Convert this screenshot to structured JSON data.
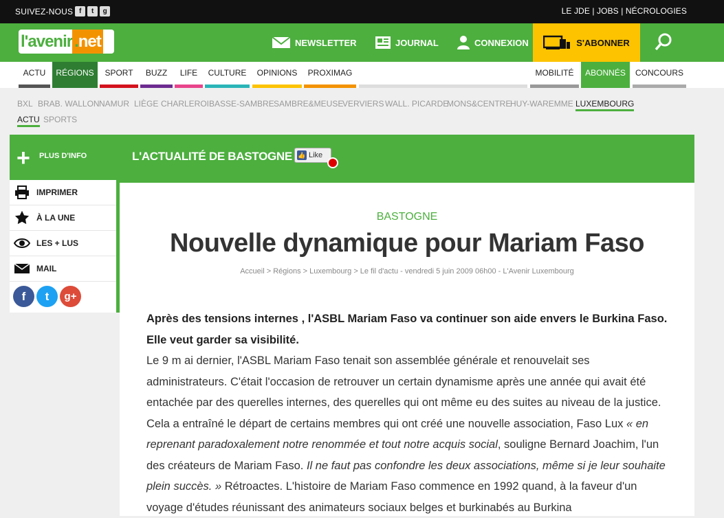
{
  "topbar": {
    "follow_label": "SUIVEZ-NOUS",
    "social_icons": [
      "facebook-icon",
      "twitter-icon",
      "googleplus-icon"
    ],
    "links": [
      "LE JDE",
      "JOBS",
      "NÉCROLOGIES"
    ],
    "sep": "|"
  },
  "header": {
    "logo_part1": "l'avenir",
    "logo_dot": ".",
    "logo_part2": "net",
    "newsletter": "NEWSLETTER",
    "journal": "JOURNAL",
    "connexion": "CONNEXION",
    "abonner": "S'ABONNER"
  },
  "menu": {
    "items": [
      {
        "label": "ACTU",
        "color": "#555555"
      },
      {
        "label": "RÉGIONS",
        "color": "#2e7d32"
      },
      {
        "label": "SPORT",
        "color": "#d3121d"
      },
      {
        "label": "BUZZ",
        "color": "#6d2c91"
      },
      {
        "label": "LIFE",
        "color": "#e8458b"
      },
      {
        "label": "CULTURE",
        "color": "#2bb5b8"
      },
      {
        "label": "OPINIONS",
        "color": "#fdc300"
      },
      {
        "label": "PROXIMAG",
        "color": "#f39200"
      }
    ],
    "right_items": [
      {
        "label": "MOBILITÉ",
        "color": "#999999"
      },
      {
        "label": "ABONNÉS",
        "color": "#4caf3e"
      },
      {
        "label": "CONCOURS",
        "color": "#aaaaaa"
      }
    ]
  },
  "submenu": {
    "regions": [
      "BXL",
      "BRAB. WALLON",
      "NAMUR",
      "LIÈGE",
      "CHARLEROI",
      "BASSE-SAMBRE",
      "SAMBRE&MEUSE",
      "VERVIERS",
      "WALL. PICARDE",
      "MONS&CENTRE",
      "HUY-WAREMME",
      "LUXEMBOURG"
    ],
    "row2": [
      "ACTU",
      "SPORTS"
    ]
  },
  "band": {
    "plus_label": "PLUS D'INFO",
    "section_title": "L'ACTUALITÉ DE BASTOGNE",
    "like": "Like"
  },
  "sidebar": {
    "items": [
      {
        "label": "IMPRIMER",
        "icon": "printer-icon"
      },
      {
        "label": "À LA UNE",
        "icon": "star-icon"
      },
      {
        "label": "LES + LUS",
        "icon": "eye-icon"
      },
      {
        "label": "MAIL",
        "icon": "mail-icon"
      }
    ],
    "share": [
      {
        "glyph": "f",
        "icon": "facebook-share-icon",
        "color": "#3b5998"
      },
      {
        "glyph": "t",
        "icon": "twitter-share-icon",
        "color": "#1da1f2"
      },
      {
        "glyph": "g+",
        "icon": "googleplus-share-icon",
        "color": "#dd4b39"
      }
    ]
  },
  "article": {
    "kicker": "BASTOGNE",
    "title": "Nouvelle dynamique pour Mariam Faso",
    "breadcrumb": "Accueil > Régions > Luxembourg > Le fil d'actu - vendredi 5 juin 2009 06h00 - L'Avenir Luxembourg",
    "lead": "Après des tensions internes , l'ASBL Mariam Faso va continuer son aide envers le Burkina Faso. Elle veut garder sa visibilité.",
    "p1": "Le 9 m ai dernier, l'ASBL Mariam Faso tenait son assemblée générale et renouvelait ses administrateurs. C'était l'occasion de retrouver un certain dynamisme après une année qui avait été entachée par des querelles internes, des querelles qui ont même eu des suites au niveau de la justice. Cela a entraîné le départ de certains membres qui ont créé une nouvelle association, Faso Lux ",
    "q1": "« en reprenant paradoxalement notre renommée et tout notre acquis social",
    "p2": ", souligne Bernard Joachim, l'un des créateurs de Mariam Faso. ",
    "q2": "Il ne faut pas confondre les deux associations, même si je leur souhaite plein succès. »",
    "p3": " Rétroactes. L'histoire de Mariam Faso commence en 1992 quand, à la faveur d'un voyage d'études réunissant des animateurs sociaux belges et burkinabés au Burkina"
  }
}
